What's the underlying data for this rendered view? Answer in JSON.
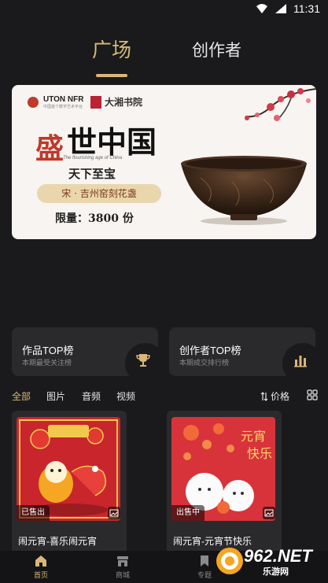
{
  "status_bar": {
    "time": "11:31"
  },
  "top_tabs": {
    "active": "广场",
    "inactive": "创作者"
  },
  "banner": {
    "brand": "UTON NFR",
    "brand_sub": "中国首个数字艺术平台",
    "partner": "大湘书院",
    "title_red": "盛",
    "title_black": "世中国",
    "english": "The flourishing age of China",
    "subtitle": "天下至宝",
    "product": "宋 · 吉州窑刻花盏",
    "limit": "限量：3800 份"
  },
  "rank_cards": [
    {
      "title": "作品TOP榜",
      "sub": "本期最受关注榜",
      "icon": "trophy-icon"
    },
    {
      "title": "创作者TOP榜",
      "sub": "本期成交排行榜",
      "icon": "bar-chart-icon"
    }
  ],
  "filters": {
    "items": [
      "全部",
      "图片",
      "音频",
      "视频"
    ],
    "price_label": "价格"
  },
  "products": [
    {
      "name": "闹元宵-喜乐闹元宵",
      "status": "已售出"
    },
    {
      "name": "闹元宵-元宵节快乐",
      "status": "出售中"
    }
  ],
  "bottom_nav": [
    {
      "label": "首页",
      "icon": "home-icon"
    },
    {
      "label": "商城",
      "icon": "store-icon"
    },
    {
      "label": "专题",
      "icon": "bookmark-icon"
    }
  ],
  "watermark": {
    "text": "962.NET",
    "sub": "乐游网"
  },
  "colors": {
    "accent": "#d9b779",
    "background": "#1a1a1c",
    "card": "#2a2a2d"
  }
}
